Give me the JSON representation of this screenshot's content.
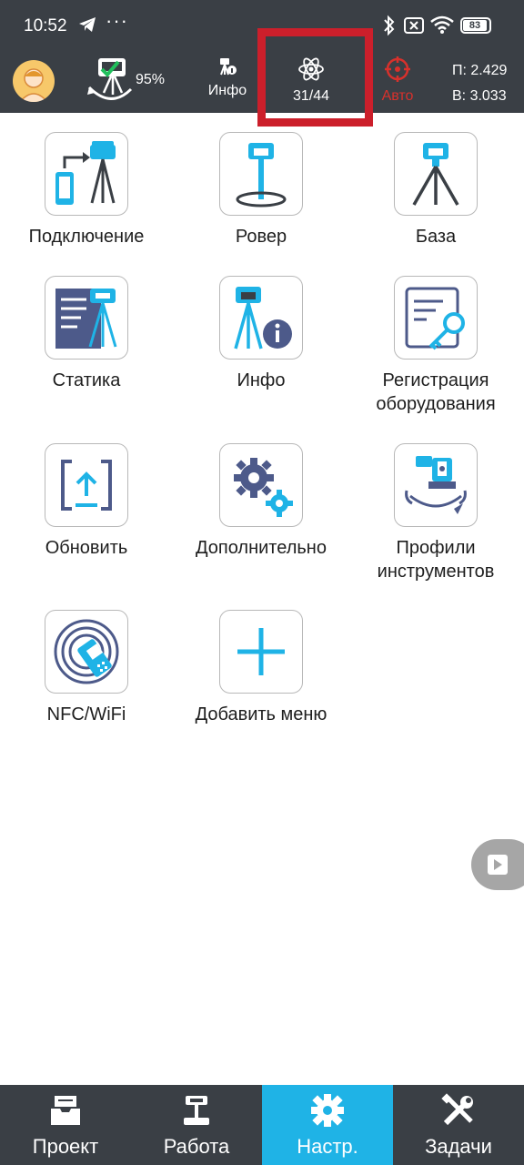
{
  "status_bar": {
    "time": "10:52",
    "battery": "83"
  },
  "header": {
    "device_battery": "95%",
    "info_label": "Инфо",
    "satellites": "31/44",
    "mode_label": "Авто",
    "p_value": "П: 2.429",
    "v_value": "В: 3.033"
  },
  "menu": {
    "connect": "Подключение",
    "rover": "Ровер",
    "base": "База",
    "static": "Статика",
    "info": "Инфо",
    "registration_1": "Регистрация",
    "registration_2": "оборудования",
    "update": "Обновить",
    "advanced": "Дополнительно",
    "profiles_1": "Профили",
    "profiles_2": "инструментов",
    "nfc": "NFC/WiFi",
    "add_menu": "Добавить меню"
  },
  "bottom_nav": {
    "project": "Проект",
    "work": "Работа",
    "settings": "Настр.",
    "tasks": "Задачи"
  },
  "colors": {
    "accent": "#1fb3e6",
    "dark": "#3a3f45",
    "highlight": "#cc1f2b",
    "alert": "#d7312c"
  }
}
